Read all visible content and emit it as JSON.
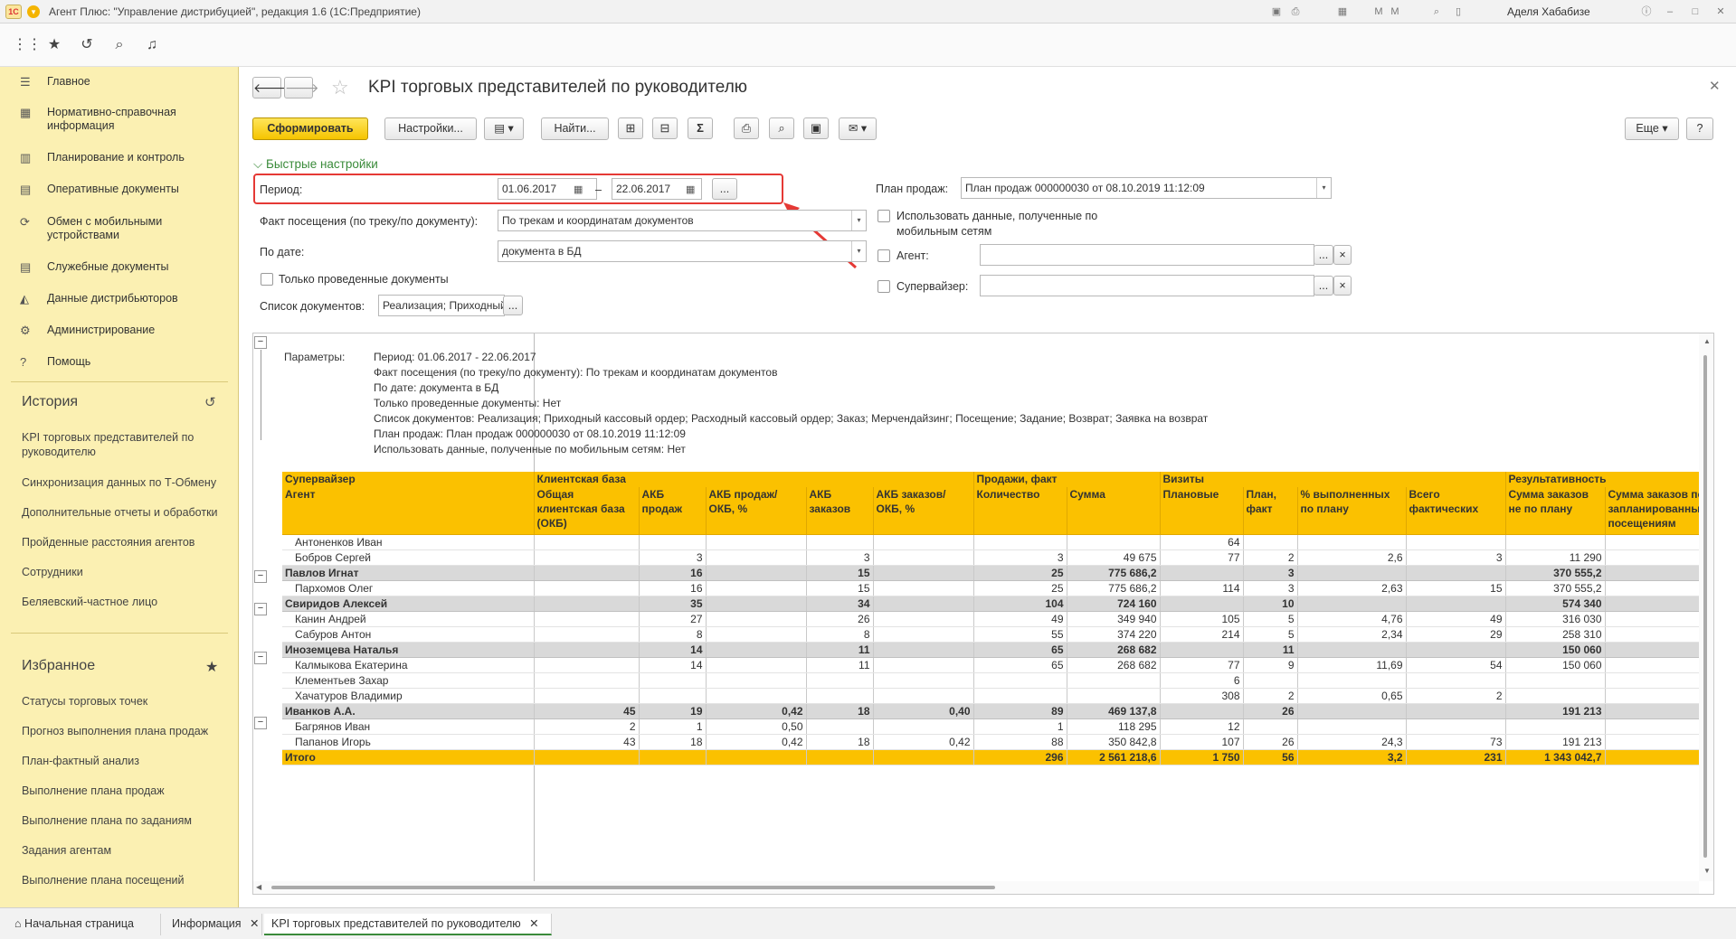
{
  "window": {
    "title": "Агент Плюс: \"Управление дистрибуцией\", редакция 1.6  (1С:Предприятие)",
    "user": "Аделя Хабабизе"
  },
  "sidebar": {
    "items": [
      {
        "label": "Главное",
        "icon": "menu-icon"
      },
      {
        "label": "Нормативно-справочная информация",
        "icon": "reference-icon"
      },
      {
        "label": "Планирование и контроль",
        "icon": "chart-icon"
      },
      {
        "label": "Оперативные документы",
        "icon": "documents-icon"
      },
      {
        "label": "Обмен с мобильными устройствами",
        "icon": "sync-icon"
      },
      {
        "label": "Служебные документы",
        "icon": "service-icon"
      },
      {
        "label": "Данные дистрибьюторов",
        "icon": "distributors-icon"
      },
      {
        "label": "Администрирование",
        "icon": "gear-icon"
      },
      {
        "label": "Помощь",
        "icon": "help-icon"
      }
    ],
    "history_title": "История",
    "history": [
      "KPI торговых представителей по руководителю",
      "Синхронизация данных по Т-Обмену",
      "Дополнительные отчеты и обработки",
      "Пройденные расстояния агентов",
      "Сотрудники",
      "Беляевский-частное лицо"
    ],
    "favorites_title": "Избранное",
    "favorites": [
      "Статусы торговых точек",
      "Прогноз выполнения плана продаж",
      "План-фактный анализ",
      "Выполнение плана продаж",
      "Выполнение плана по заданиям",
      "Задания агентам",
      "Выполнение плана посещений"
    ]
  },
  "form": {
    "title": "KPI торговых представителей по руководителю",
    "generate_label": "Сформировать",
    "settings_label": "Настройки...",
    "find_label": "Найти...",
    "more_label": "Еще",
    "help_label": "?",
    "quick_settings_label": "Быстрые настройки",
    "period_label": "Период:",
    "period_from": "01.06.2017",
    "period_to": "22.06.2017",
    "period_dash": "–",
    "fact_label": "Факт посещения (по треку/по документу):",
    "fact_value": "По трекам и координатам документов",
    "bydate_label": "По дате:",
    "bydate_value": "документа в БД",
    "posted_only_label": "Только проведенные документы",
    "doclist_label": "Список документов:",
    "doclist_value": "Реализация; Приходный кассовый ордер",
    "plan_label": "План продаж:",
    "plan_value": "План продаж 000000030 от 08.10.2019 11:12:09",
    "mobile_label": "Использовать данные, полученные по мобильным сетям",
    "agent_label": "Агент:",
    "supervisor_label": "Супервайзер:",
    "ellipsis": "...",
    "clear": "×"
  },
  "report": {
    "params_label": "Параметры:",
    "params": [
      "Период: 01.06.2017 - 22.06.2017",
      "Факт посещения (по треку/по документу): По трекам и координатам документов",
      "По дате: документа в БД",
      "Только проведенные документы: Нет",
      "Список документов: Реализация; Приходный кассовый ордер; Расходный кассовый ордер; Заказ; Мерчендайзинг; Посещение; Задание; Возврат; Заявка на возврат",
      "План продаж: План продаж 000000030 от 08.10.2019 11:12:09",
      "Использовать данные, полученные по мобильным сетям: Нет"
    ],
    "header_groups": [
      "Супервайзер",
      "Клиентская база",
      "Продажи, факт",
      "Визиты",
      "Результативность"
    ],
    "columns": [
      "Агент",
      "Общая клиентская база (ОКБ)",
      "АКБ продаж",
      "АКБ продаж/ОКБ, %",
      "АКБ заказов",
      "АКБ заказов/ОКБ, %",
      "Количество",
      "Сумма",
      "Плановые",
      "План, факт",
      "% выполненных по плану",
      "Всего фактических",
      "Сумма заказов не по плану",
      "Сумма заказов по запланированным посещениям"
    ],
    "rows": [
      {
        "t": "a",
        "c": [
          "Антоненков Иван",
          "",
          "",
          "",
          "",
          "",
          "",
          "",
          "64",
          "",
          "",
          "",
          "",
          ""
        ]
      },
      {
        "t": "a",
        "c": [
          "Бобров Сергей",
          "",
          "3",
          "",
          "3",
          "",
          "3",
          "49 675",
          "77",
          "2",
          "2,6",
          "3",
          "11 290",
          ""
        ]
      },
      {
        "t": "g",
        "c": [
          "Павлов Игнат",
          "",
          "16",
          "",
          "15",
          "",
          "25",
          "775 686,2",
          "",
          "3",
          "",
          "",
          "370 555,2",
          ""
        ]
      },
      {
        "t": "a",
        "c": [
          "Пархомов Олег",
          "",
          "16",
          "",
          "15",
          "",
          "25",
          "775 686,2",
          "114",
          "3",
          "2,63",
          "15",
          "370 555,2",
          ""
        ]
      },
      {
        "t": "g",
        "c": [
          "Свиридов Алексей",
          "",
          "35",
          "",
          "34",
          "",
          "104",
          "724 160",
          "",
          "10",
          "",
          "",
          "574 340",
          ""
        ]
      },
      {
        "t": "a",
        "c": [
          "Канин Андрей",
          "",
          "27",
          "",
          "26",
          "",
          "49",
          "349 940",
          "105",
          "5",
          "4,76",
          "49",
          "316 030",
          ""
        ]
      },
      {
        "t": "a",
        "c": [
          "Сабуров Антон",
          "",
          "8",
          "",
          "8",
          "",
          "55",
          "374 220",
          "214",
          "5",
          "2,34",
          "29",
          "258 310",
          ""
        ]
      },
      {
        "t": "g",
        "c": [
          "Иноземцева Наталья",
          "",
          "14",
          "",
          "11",
          "",
          "65",
          "268 682",
          "",
          "11",
          "",
          "",
          "150 060",
          ""
        ]
      },
      {
        "t": "a",
        "c": [
          "Калмыкова Екатерина",
          "",
          "14",
          "",
          "11",
          "",
          "65",
          "268 682",
          "77",
          "9",
          "11,69",
          "54",
          "150 060",
          ""
        ]
      },
      {
        "t": "a",
        "c": [
          "Клементьев Захар",
          "",
          "",
          "",
          "",
          "",
          "",
          "",
          "6",
          "",
          "",
          "",
          "",
          ""
        ]
      },
      {
        "t": "a",
        "c": [
          "Хачатуров Владимир",
          "",
          "",
          "",
          "",
          "",
          "",
          "",
          "308",
          "2",
          "0,65",
          "2",
          "",
          ""
        ]
      },
      {
        "t": "g",
        "c": [
          "Иванков А.А.",
          "45",
          "19",
          "0,42",
          "18",
          "0,40",
          "89",
          "469 137,8",
          "",
          "26",
          "",
          "",
          "191 213",
          ""
        ]
      },
      {
        "t": "a",
        "c": [
          "Багрянов Иван",
          "2",
          "1",
          "0,50",
          "",
          "",
          "1",
          "118 295",
          "12",
          "",
          "",
          "",
          "",
          ""
        ]
      },
      {
        "t": "a",
        "c": [
          "Папанов Игорь",
          "43",
          "18",
          "0,42",
          "18",
          "0,42",
          "88",
          "350 842,8",
          "107",
          "26",
          "24,3",
          "73",
          "191 213",
          ""
        ]
      },
      {
        "t": "t",
        "c": [
          "Итого",
          "",
          "",
          "",
          "",
          "",
          "296",
          "2 561 218,6",
          "1 750",
          "56",
          "3,2",
          "231",
          "1 343 042,7",
          ""
        ]
      }
    ]
  },
  "tabs": [
    "Начальная страница",
    "Информация",
    "KPI торговых представителей по руководителю"
  ],
  "colors": {
    "accent": "#fbc100",
    "sidebar": "#fbf0b2",
    "highlight": "#e53935"
  }
}
